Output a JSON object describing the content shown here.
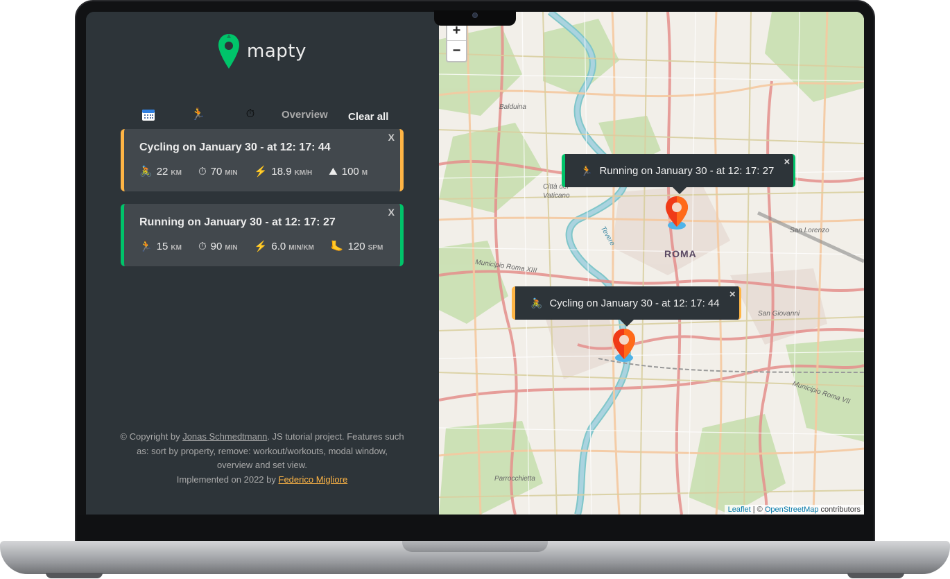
{
  "app": {
    "name": "mapty",
    "brand_green": "#00c46a",
    "brand_orange": "#ffb545"
  },
  "toolbar": {
    "sort_date_icon": "calendar-icon",
    "sort_type_icon": "runner-icon",
    "sort_duration_icon": "stopwatch-icon",
    "overview_label": "Overview",
    "clear_label": "Clear all"
  },
  "workouts": [
    {
      "type": "cycling",
      "title": "Cycling on January 30 - at 12: 17: 44",
      "close": "X",
      "stats": [
        {
          "icon": "🚴",
          "value": "22",
          "unit": "km"
        },
        {
          "icon": "⏱",
          "value": "70",
          "unit": "min"
        },
        {
          "icon": "⚡",
          "value": "18.9",
          "unit": "km/h"
        },
        {
          "icon": "⛰",
          "value": "100",
          "unit": "m"
        }
      ]
    },
    {
      "type": "running",
      "title": "Running on January 30 - at 12: 17: 27",
      "close": "X",
      "stats": [
        {
          "icon": "🏃",
          "value": "15",
          "unit": "km"
        },
        {
          "icon": "⏱",
          "value": "90",
          "unit": "min"
        },
        {
          "icon": "⚡",
          "value": "6.0",
          "unit": "min/km"
        },
        {
          "icon": "🦶",
          "value": "120",
          "unit": "spm"
        }
      ]
    }
  ],
  "copyright": {
    "prefix": "© Copyright by ",
    "author": "Jonas Schmedtmann",
    "middle": ". JS tutorial project. Features such as: sort by property, remove: workout/workouts, modal window, overview and set view.",
    "impl_prefix": "Implemented on 2022 by ",
    "implementer": "Federico Migliore"
  },
  "map": {
    "zoom_in": "+",
    "zoom_out": "−",
    "popups": [
      {
        "icon": "🏃",
        "text": "Running on January 30 - at 12: 17: 27",
        "close": "×"
      },
      {
        "icon": "🚴",
        "text": "Cycling on January 30 - at 12: 17: 44",
        "close": "×"
      }
    ],
    "labels": {
      "roma": "ROMA",
      "balduina": "Balduina",
      "vaticano": "Città del Vaticano",
      "municipio_xiii": "Municipio Roma XIII",
      "san_lorenzo": "San Lorenzo",
      "san_giovanni": "San Giovanni",
      "municipio_vii": "Municipio Roma VII",
      "parrocchietta": "Parrocchietta",
      "tevere": "Tevere"
    },
    "attribution": {
      "leaflet": "Leaflet",
      "sep": " | © ",
      "osm": "OpenStreetMap",
      "suffix": " contributors"
    }
  }
}
